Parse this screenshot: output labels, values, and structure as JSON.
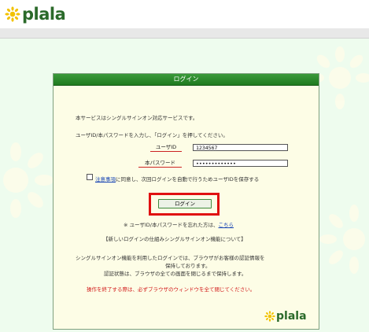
{
  "brand": {
    "name": "plala"
  },
  "panel": {
    "title": "ログイン",
    "intro": "本サービスはシングルサインオン対応サービスです。",
    "instruction": "ユーザID/本パスワードを入力し、「ログイン」を押してください。",
    "userid_label": "ユーザID",
    "userid_value": "1234567",
    "password_label": "本パスワード",
    "password_value": "•••••••••••••",
    "consent_link": "注意事項",
    "consent_text": "に同意し、次回ログインを自動で行うためユーザIDを保存する",
    "login_button": "ログイン",
    "forgot_text": "※ ユーザID/本パスワードを忘れた方は、",
    "forgot_link": "こちら",
    "sso_heading": "【新しいログインの仕組みシングルサインオン機能について】",
    "sso_line1": "シングルサインオン機能を利用したログインでは、ブラウザがお客様の認証情報を",
    "sso_line2": "保持しております。",
    "sso_line3": "認証状態は、ブラウザの全ての画面を閉じるまで保持します。",
    "warning": "操作を終了する際は、必ずブラウザのウィンドウを全て閉じてください。"
  },
  "colors": {
    "accent_green": "#1f7a1f",
    "highlight_red": "#e01010",
    "link_blue": "#1a46b4",
    "logo_yellow": "#f2c200"
  }
}
